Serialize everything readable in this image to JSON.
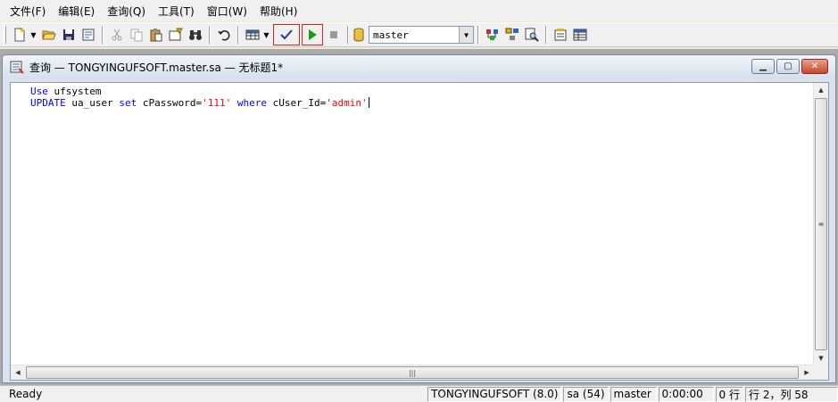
{
  "menu": [
    "文件(F)",
    "编辑(E)",
    "查询(Q)",
    "工具(T)",
    "窗口(W)",
    "帮助(H)"
  ],
  "toolbar": {
    "database": "master"
  },
  "window": {
    "title": "查询 — TONGYINGUFSOFT.master.sa — 无标题1*"
  },
  "editor": {
    "line1": {
      "kw": "Use",
      "rest": " ufsystem"
    },
    "line2": {
      "kw1": "UPDATE",
      "p1": " ua_user ",
      "kw2": "set",
      "p2": " cPassword=",
      "s1": "'111'",
      "p3": " ",
      "kw3": "where",
      "p4": " cUser_Id=",
      "s2": "'admin'"
    }
  },
  "status": {
    "ready": "Ready",
    "server": "TONGYINGUFSOFT (8.0)",
    "user": "sa (54)",
    "db": "master",
    "time": "0:00:00",
    "rows": "0 行",
    "position": "行 2，列 58"
  }
}
